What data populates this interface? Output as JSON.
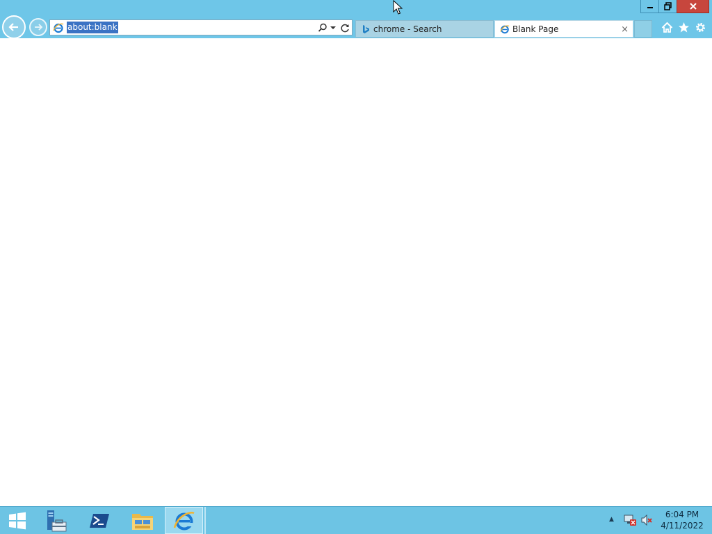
{
  "window": {
    "minimize_icon": "minimize-icon",
    "maximize_icon": "restore-icon",
    "close_icon": "close-icon"
  },
  "navigation": {
    "back_icon": "back-arrow-icon",
    "forward_icon": "forward-arrow-icon"
  },
  "address_bar": {
    "value": "about:blank",
    "site_icon": "ie-icon",
    "search_icon": "search-icon",
    "dropdown_icon": "chevron-down-icon",
    "refresh_icon": "refresh-icon"
  },
  "tabs": [
    {
      "label": "chrome - Search",
      "icon": "bing-icon",
      "active": false
    },
    {
      "label": "Blank Page",
      "icon": "ie-icon",
      "active": true,
      "close": "×"
    }
  ],
  "toolbar": {
    "home_icon": "home-icon",
    "favorites_icon": "star-icon",
    "tools_icon": "gear-icon"
  },
  "taskbar": {
    "start_icon": "windows-start-icon",
    "pinned": [
      "server-manager-icon",
      "powershell-icon",
      "file-explorer-icon",
      "internet-explorer-icon"
    ],
    "tray": {
      "show_hidden": "▲",
      "network_icon": "network-error-icon",
      "volume_icon": "volume-muted-icon"
    },
    "clock": {
      "time": "6:04 PM",
      "date": "4/11/2022"
    }
  },
  "colors": {
    "chrome": "#6ec6e8",
    "taskbar": "#6dc4e4",
    "selection": "#3b73c4",
    "close_red": "#c7463d"
  }
}
